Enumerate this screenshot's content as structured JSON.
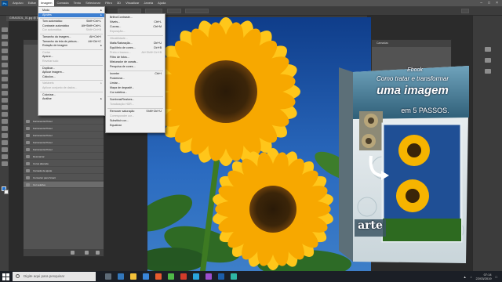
{
  "menubar": {
    "logo": "Ps",
    "items": [
      "Arquivo",
      "Editar",
      "Imagem",
      "Camada",
      "Texto",
      "Selecionar",
      "Filtro",
      "3D",
      "Visualizar",
      "Janela",
      "Ajuda"
    ],
    "active_index": 2
  },
  "document_tab": "GIRASSOL_01.jpg @ 66,7% (RGB/8#)",
  "image_menu": {
    "items": [
      {
        "label": "Modo",
        "shortcut": "",
        "arrow": true,
        "disabled": false,
        "highlight": false
      },
      {
        "label": "Ajustes",
        "shortcut": "",
        "arrow": true,
        "disabled": false,
        "highlight": true
      },
      {
        "label": "Tom automático",
        "shortcut": "Shift+Ctrl+L",
        "arrow": false,
        "disabled": false,
        "highlight": false
      },
      {
        "label": "Contraste automático",
        "shortcut": "Alt+Shift+Ctrl+L",
        "arrow": false,
        "disabled": false,
        "highlight": false
      },
      {
        "label": "Cor automática",
        "shortcut": "Shift+Ctrl+B",
        "arrow": false,
        "disabled": true,
        "highlight": false
      },
      {
        "label": "Tamanho da imagem...",
        "shortcut": "Alt+Ctrl+I",
        "arrow": false,
        "disabled": false,
        "highlight": false
      },
      {
        "label": "Tamanho da tela de pintura...",
        "shortcut": "Alt+Ctrl+C",
        "arrow": false,
        "disabled": false,
        "highlight": false
      },
      {
        "label": "Rotação de imagem",
        "shortcut": "",
        "arrow": true,
        "disabled": false,
        "highlight": false
      },
      {
        "label": "Cortar",
        "shortcut": "",
        "arrow": false,
        "disabled": true,
        "highlight": false
      },
      {
        "label": "Aparar...",
        "shortcut": "",
        "arrow": false,
        "disabled": false,
        "highlight": false
      },
      {
        "label": "Revelar tudo",
        "shortcut": "",
        "arrow": false,
        "disabled": true,
        "highlight": false
      },
      {
        "label": "Duplicar...",
        "shortcut": "",
        "arrow": false,
        "disabled": false,
        "highlight": false
      },
      {
        "label": "Aplicar imagem...",
        "shortcut": "",
        "arrow": false,
        "disabled": false,
        "highlight": false
      },
      {
        "label": "Cálculos...",
        "shortcut": "",
        "arrow": false,
        "disabled": false,
        "highlight": false
      },
      {
        "label": "Variáveis",
        "shortcut": "",
        "arrow": true,
        "disabled": true,
        "highlight": false
      },
      {
        "label": "Aplicar conjunto de dados...",
        "shortcut": "",
        "arrow": false,
        "disabled": true,
        "highlight": false
      },
      {
        "label": "Colorizar...",
        "shortcut": "",
        "arrow": false,
        "disabled": false,
        "highlight": false
      },
      {
        "label": "Análise",
        "shortcut": "",
        "arrow": true,
        "disabled": false,
        "highlight": false
      }
    ]
  },
  "adjust_submenu": {
    "items": [
      {
        "label": "Brilho/Contraste...",
        "shortcut": "",
        "disabled": false
      },
      {
        "label": "Níveis...",
        "shortcut": "Ctrl+L",
        "disabled": false
      },
      {
        "label": "Curvas...",
        "shortcut": "Ctrl+M",
        "disabled": false
      },
      {
        "label": "Exposição...",
        "shortcut": "",
        "disabled": true
      },
      {
        "label": "Vibratilidade...",
        "shortcut": "",
        "disabled": true
      },
      {
        "label": "Matiz/Saturação...",
        "shortcut": "Ctrl+U",
        "disabled": false
      },
      {
        "label": "Equilíbrio de cores...",
        "shortcut": "Ctrl+B",
        "disabled": false
      },
      {
        "label": "Preto e branco...",
        "shortcut": "Alt+Shift+Ctrl+B",
        "disabled": true
      },
      {
        "label": "Filtro de fotos...",
        "shortcut": "",
        "disabled": false
      },
      {
        "label": "Misturador de canais...",
        "shortcut": "",
        "disabled": false
      },
      {
        "label": "Pesquisa de cores...",
        "shortcut": "",
        "disabled": false
      },
      {
        "label": "Inverter",
        "shortcut": "Ctrl+I",
        "disabled": false
      },
      {
        "label": "Posterizar...",
        "shortcut": "",
        "disabled": false
      },
      {
        "label": "Limiar...",
        "shortcut": "",
        "disabled": false
      },
      {
        "label": "Mapa de degradê...",
        "shortcut": "",
        "disabled": false
      },
      {
        "label": "Cor seletiva...",
        "shortcut": "",
        "disabled": false
      },
      {
        "label": "Sombras/Realces...",
        "shortcut": "",
        "disabled": false
      },
      {
        "label": "Tonalização HDR...",
        "shortcut": "",
        "disabled": true
      },
      {
        "label": "Remover saturação",
        "shortcut": "Shift+Ctrl+U",
        "disabled": false
      },
      {
        "label": "Corresponder cor...",
        "shortcut": "",
        "disabled": true
      },
      {
        "label": "Substituir cor...",
        "shortcut": "",
        "disabled": false
      },
      {
        "label": "Equalizar",
        "shortcut": "",
        "disabled": false
      }
    ]
  },
  "history": {
    "rows": [
      "Ferramenta Pincel",
      "Ferramenta Pincel",
      "Ferramenta Pincel",
      "Ferramenta Pincel",
      "Ferramenta Pincel",
      "Desmarcar",
      "Curva alterada",
      "Camada de ajuste",
      "Converter para Smart",
      "Cor seletiva"
    ],
    "selected_index": 9
  },
  "right_panel": {
    "title": "Camadas"
  },
  "ebook": {
    "kicker": "Ebook",
    "title_line1": "Como tratar e transformar",
    "title_line2": "uma imagem",
    "steps": "em 5 PASSOS.",
    "brand": "arte"
  },
  "taskbar": {
    "search_placeholder": "Digite aqui para pesquisar",
    "time": "07:14",
    "date": "22/03/2019"
  },
  "colors": {
    "menu_highlight": "#3d7fd1",
    "foreground": "#1e74d6",
    "ebook_blue": "#3d6b82"
  }
}
